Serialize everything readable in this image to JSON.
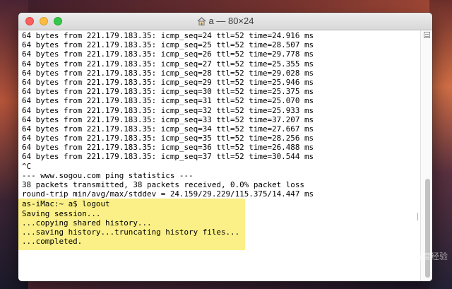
{
  "window": {
    "title": "a — 80×24"
  },
  "terminal": {
    "lines": [
      "64 bytes from 221.179.183.35: icmp_seq=24 ttl=52 time=24.916 ms",
      "64 bytes from 221.179.183.35: icmp_seq=25 ttl=52 time=28.507 ms",
      "64 bytes from 221.179.183.35: icmp_seq=26 ttl=52 time=29.778 ms",
      "64 bytes from 221.179.183.35: icmp_seq=27 ttl=52 time=25.355 ms",
      "64 bytes from 221.179.183.35: icmp_seq=28 ttl=52 time=29.028 ms",
      "64 bytes from 221.179.183.35: icmp_seq=29 ttl=52 time=25.946 ms",
      "64 bytes from 221.179.183.35: icmp_seq=30 ttl=52 time=25.375 ms",
      "64 bytes from 221.179.183.35: icmp_seq=31 ttl=52 time=25.070 ms",
      "64 bytes from 221.179.183.35: icmp_seq=32 ttl=52 time=25.933 ms",
      "64 bytes from 221.179.183.35: icmp_seq=33 ttl=52 time=37.207 ms",
      "64 bytes from 221.179.183.35: icmp_seq=34 ttl=52 time=27.667 ms",
      "64 bytes from 221.179.183.35: icmp_seq=35 ttl=52 time=28.256 ms",
      "64 bytes from 221.179.183.35: icmp_seq=36 ttl=52 time=26.488 ms",
      "64 bytes from 221.179.183.35: icmp_seq=37 ttl=52 time=30.544 ms",
      "^C",
      "--- www.sogou.com ping statistics ---",
      "38 packets transmitted, 38 packets received, 0.0% packet loss",
      "round-trip min/avg/max/stddev = 24.159/29.229/115.375/14.447 ms"
    ],
    "highlighted_lines": [
      "as-iMac:~ a$ logout",
      "Saving session...",
      "...copying shared history...",
      "...saving history...truncating history files...",
      "...completed."
    ]
  },
  "icons": {
    "title": "home-icon"
  },
  "colors": {
    "highlight": "#fbf087",
    "close": "#fc605c",
    "minimize": "#fdbc40",
    "maximize": "#34c84a"
  },
  "watermark": {
    "text": "百度经验"
  }
}
